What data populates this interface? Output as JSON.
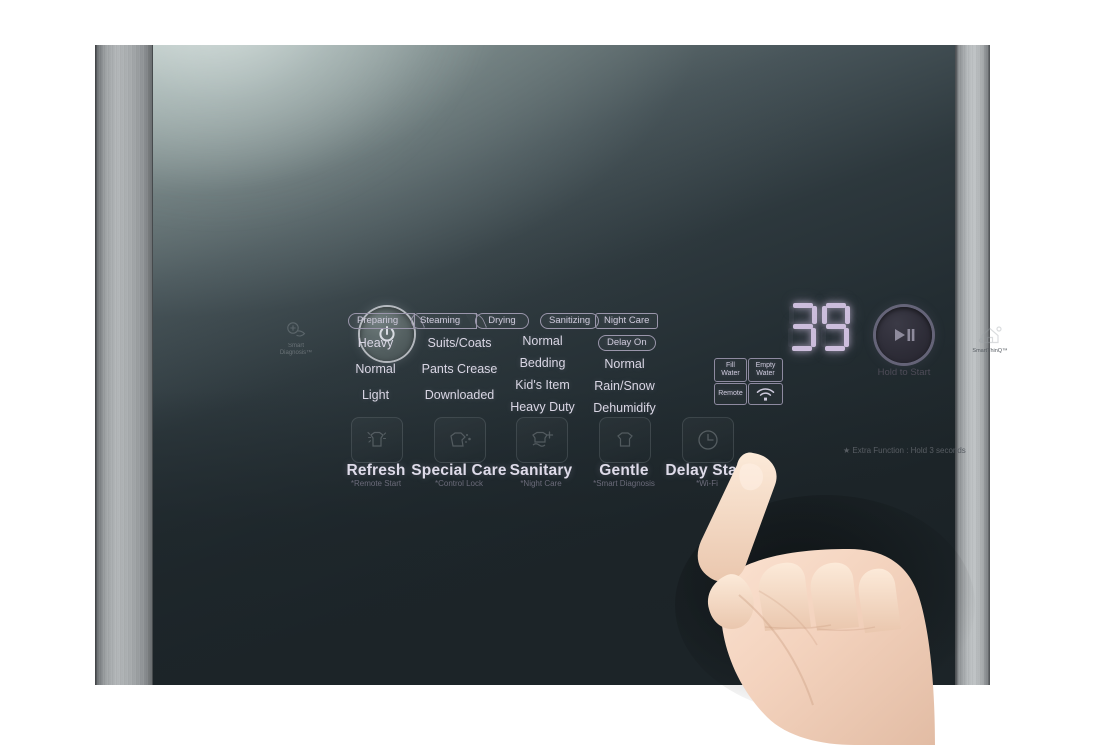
{
  "device": {
    "brand_feature_left": "Smart Diagnosis™",
    "brand_feature_right": "SmartThinQ™"
  },
  "power": {
    "name": "power-button",
    "icon": "power-icon"
  },
  "progress_chips": [
    {
      "label": "Preparing",
      "shape": "arrow"
    },
    {
      "label": "Steaming",
      "shape": "arrow"
    },
    {
      "label": "Drying",
      "shape": "round"
    },
    {
      "label": "Sanitizing",
      "shape": "round"
    },
    {
      "label": "Night Care",
      "shape": "square"
    }
  ],
  "delay_on_chip": {
    "label": "Delay On"
  },
  "option_columns": [
    {
      "name": "column-1",
      "options": [
        "Heavy",
        "Normal",
        "Light"
      ]
    },
    {
      "name": "column-2",
      "options": [
        "Suits/Coats",
        "Pants Crease",
        "Downloaded"
      ]
    },
    {
      "name": "column-3",
      "options": [
        "Normal",
        "Bedding",
        "Kid's Item",
        "Heavy Duty"
      ]
    },
    {
      "name": "column-4",
      "options": [
        "Normal",
        "Rain/Snow",
        "Dehumidify"
      ]
    }
  ],
  "display": {
    "value": "39",
    "digits": [
      "3",
      "9"
    ],
    "color": "#cdbedd"
  },
  "status_badges": [
    {
      "label": "Fill Water",
      "lines": [
        "Fill",
        "Water"
      ]
    },
    {
      "label": "Empty Water",
      "lines": [
        "Empty",
        "Water"
      ]
    },
    {
      "label": "Remote",
      "lines": [
        "Remote"
      ]
    },
    {
      "label": "Wi-Fi",
      "lines": [],
      "icon": "wifi-icon"
    }
  ],
  "start_button": {
    "label": "Hold to Start",
    "icon": "play-pause-icon"
  },
  "function_buttons": [
    {
      "name": "refresh",
      "label": "Refresh",
      "sub": "*Remote Start",
      "icon": "garment-refresh-icon"
    },
    {
      "name": "special-care",
      "label": "Special Care",
      "sub": "*Control Lock",
      "icon": "garment-special-icon"
    },
    {
      "name": "sanitary",
      "label": "Sanitary",
      "sub": "*Night Care",
      "icon": "garment-sanitary-icon"
    },
    {
      "name": "gentle",
      "label": "Gentle",
      "sub": "*Smart Diagnosis",
      "icon": "garment-gentle-icon"
    },
    {
      "name": "delay-start",
      "label": "Delay Start",
      "sub": "*Wi-Fi",
      "icon": "clock-icon"
    }
  ],
  "extra_function_note": "★ Extra Function : Hold 3 seconds",
  "colors": {
    "display_accent": "#cdbedd",
    "panel_dark": "#1d2529",
    "panel_light": "#8c9a99",
    "frame_metal": "#b2b6b8",
    "label_text": "#d8d5e2"
  }
}
